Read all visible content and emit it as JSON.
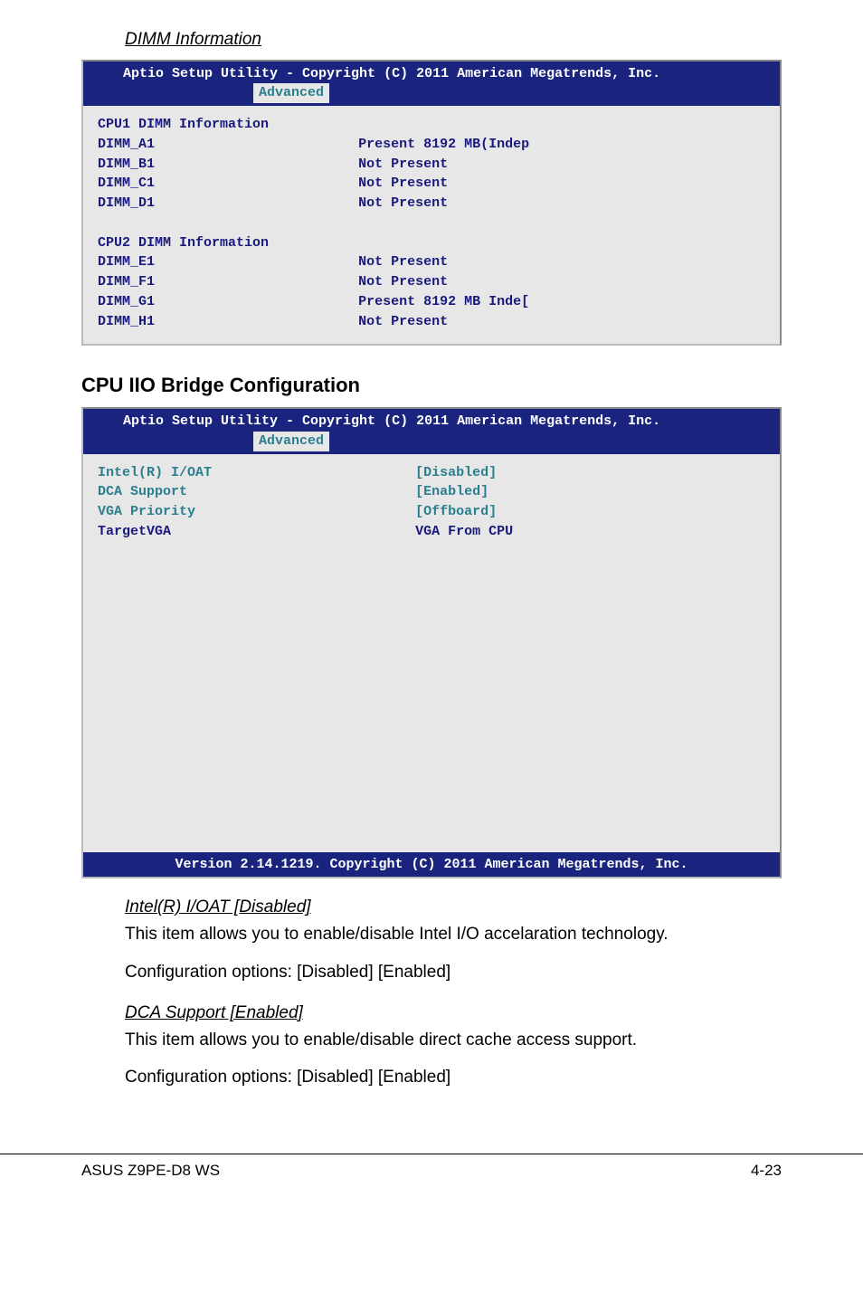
{
  "document": {
    "dimm_section_title": "DIMM Information",
    "iio_section_title": "CPU IIO Bridge Configuration",
    "sub1_title": "Intel(R) I/OAT [Disabled]",
    "sub1_text": "This item allows you to enable/disable Intel I/O accelaration technology.",
    "sub1_conf": "Configuration options: [Disabled] [Enabled]",
    "sub2_title": "DCA Support [Enabled]",
    "sub2_text": "This item allows you to enable/disable direct cache access support.",
    "sub2_conf": "Configuration options: [Disabled] [Enabled]"
  },
  "bios_common": {
    "header": "Aptio Setup Utility - Copyright (C) 2011 American Megatrends, Inc.",
    "tab_label": "Advanced",
    "footer": "Version 2.14.1219. Copyright (C) 2011 American Megatrends, Inc."
  },
  "dimm_panel": {
    "cpu1_header": "CPU1 DIMM Information",
    "rows1": [
      {
        "slot": "DIMM_A1",
        "status": "Present 8192 MB(Indep"
      },
      {
        "slot": "DIMM_B1",
        "status": "Not Present"
      },
      {
        "slot": "DIMM_C1",
        "status": "Not Present"
      },
      {
        "slot": "DIMM_D1",
        "status": "Not Present"
      }
    ],
    "cpu2_header": "CPU2 DIMM Information",
    "rows2": [
      {
        "slot": "DIMM_E1",
        "status": "Not Present"
      },
      {
        "slot": "DIMM_F1",
        "status": "Not Present"
      },
      {
        "slot": "DIMM_G1",
        "status": "Present 8192 MB Inde["
      },
      {
        "slot": "DIMM_H1",
        "status": "Not Present"
      }
    ]
  },
  "iio_panel": {
    "rows": [
      {
        "label": "Intel(R) I/OAT",
        "value": "[Disabled]",
        "interactive": true
      },
      {
        "label": "DCA Support",
        "value": "[Enabled]",
        "interactive": true
      },
      {
        "label": "VGA Priority",
        "value": "[Offboard]",
        "interactive": true
      }
    ],
    "target_label": "TargetVGA",
    "target_value": "VGA From CPU"
  },
  "footer": {
    "left": "ASUS Z9PE-D8 WS",
    "right": "4-23"
  }
}
